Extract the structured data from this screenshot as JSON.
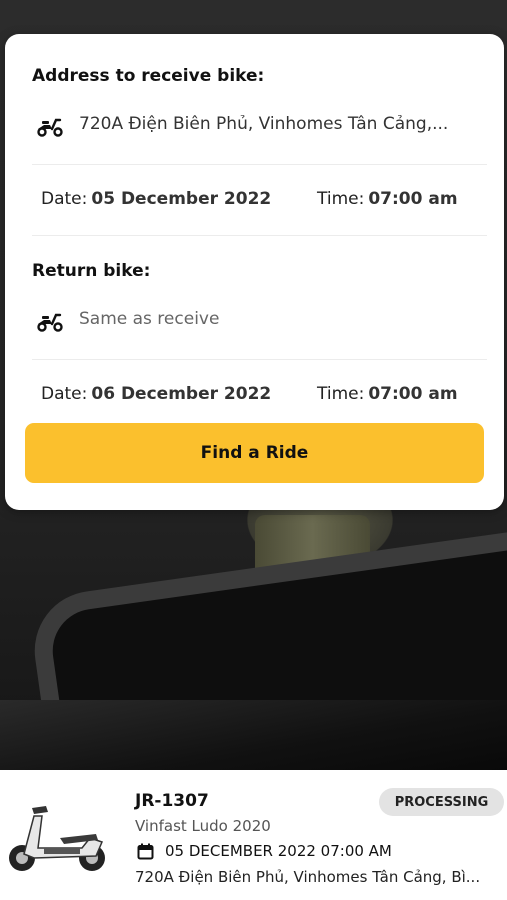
{
  "booking_form": {
    "receive": {
      "title": "Address to receive bike:",
      "address": "720A Điện Biên Phủ, Vinhomes Tân Cảng,...",
      "date_label": "Date:",
      "date_value": "05 December 2022",
      "time_label": "Time:",
      "time_value": "07:00 am",
      "icon": "scooter-icon"
    },
    "return": {
      "title": "Return bike:",
      "address": "Same as receive",
      "date_label": "Date:",
      "date_value": "06 December 2022",
      "time_label": "Time:",
      "time_value": "07:00 am",
      "icon": "scooter-icon"
    },
    "find_button_label": "Find a Ride",
    "accent_color": "#fbc02d"
  },
  "order": {
    "id": "JR-1307",
    "status": "PROCESSING",
    "model": "Vinfast Ludo 2020",
    "datetime": "05 DECEMBER 2022 07:00 AM",
    "address": "720A Điện Biên Phủ, Vinhomes Tân Cảng, Bì...",
    "icon": "calendar-icon"
  }
}
